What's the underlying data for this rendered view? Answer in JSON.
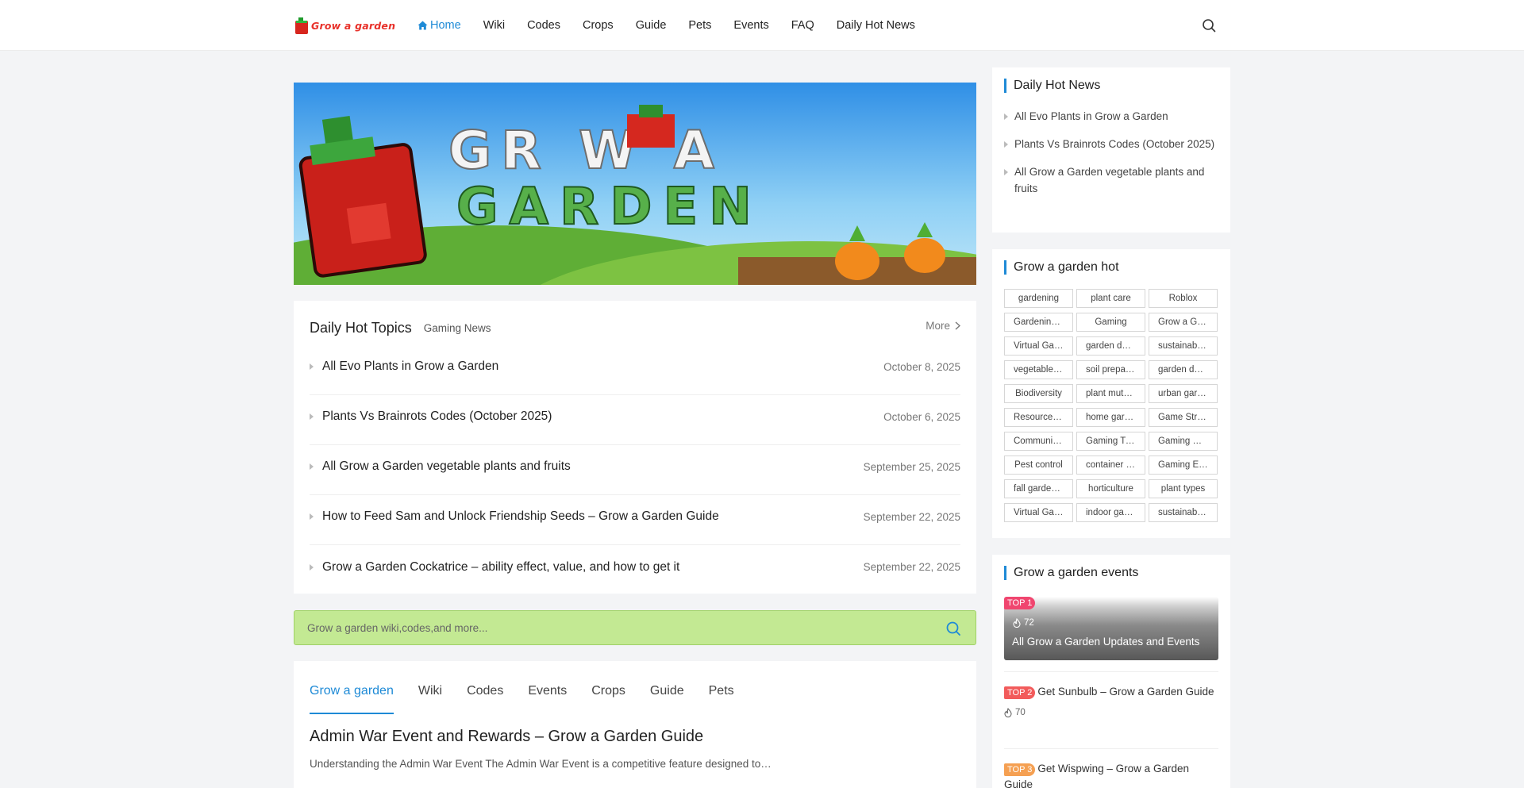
{
  "header": {
    "logo_text": "Grow a garden",
    "nav": [
      {
        "label": "Home",
        "active": true
      },
      {
        "label": "Wiki"
      },
      {
        "label": "Codes"
      },
      {
        "label": "Crops"
      },
      {
        "label": "Guide"
      },
      {
        "label": "Pets"
      },
      {
        "label": "Events"
      },
      {
        "label": "FAQ"
      },
      {
        "label": "Daily Hot News"
      }
    ]
  },
  "banner": {
    "text_line1": "GR W A",
    "text_line2": "GARDEN"
  },
  "topics": {
    "title": "Daily Hot Topics",
    "subtitle": "Gaming News",
    "more_label": "More",
    "items": [
      {
        "title": "All Evo Plants in Grow a Garden",
        "date": "October 8, 2025"
      },
      {
        "title": "Plants Vs Brainrots Codes (October 2025)",
        "date": "October 6, 2025"
      },
      {
        "title": "All Grow a Garden vegetable plants and fruits",
        "date": "September 25, 2025"
      },
      {
        "title": "How to Feed Sam and Unlock Friendship Seeds – Grow a Garden Guide",
        "date": "September 22, 2025"
      },
      {
        "title": "Grow a Garden Cockatrice – ability effect, value, and how to get it",
        "date": "September 22, 2025"
      }
    ]
  },
  "search": {
    "placeholder": "Grow a garden wiki,codes,and more..."
  },
  "tabs": {
    "items": [
      {
        "label": "Grow a garden",
        "active": true
      },
      {
        "label": "Wiki"
      },
      {
        "label": "Codes"
      },
      {
        "label": "Events"
      },
      {
        "label": "Crops"
      },
      {
        "label": "Guide"
      },
      {
        "label": "Pets"
      }
    ],
    "article_title": "Admin War Event and Rewards – Grow a Garden Guide",
    "article_excerpt": "Understanding the Admin War Event The Admin War Event is a competitive feature designed to…"
  },
  "sidebar": {
    "news": {
      "title": "Daily Hot News",
      "items": [
        "All Evo Plants in Grow a Garden",
        "Plants Vs Brainrots Codes (October 2025)",
        "All Grow a Garden vegetable plants and fruits"
      ]
    },
    "hot": {
      "title": "Grow a garden hot",
      "tags": [
        "gardening",
        "plant care",
        "Roblox",
        "Gardening Tips",
        "Gaming",
        "Grow a Garden",
        "Virtual Gardening",
        "garden design",
        "sustainable gardening",
        "vegetable gardening",
        "soil preparation",
        "garden decor",
        "Biodiversity",
        "plant mutations",
        "urban gardening",
        "Resource Management",
        "home gardening",
        "Game Strategy",
        "Community Events",
        "Gaming Tips",
        "Gaming Guide",
        "Pest control",
        "container gardening",
        "Gaming Events",
        "fall gardening",
        "horticulture",
        "plant types",
        "Virtual Garden",
        "indoor gardening",
        "sustainable living"
      ]
    },
    "events": {
      "title": "Grow a garden events",
      "items": [
        {
          "rank": "TOP 1",
          "title": "All Grow a Garden Updates and Events",
          "likes": "72"
        },
        {
          "rank": "TOP 2",
          "title": "Get Sunbulb – Grow a Garden Guide",
          "likes": "70"
        },
        {
          "rank": "TOP 3",
          "title": "Get Wispwing – Grow a Garden Guide",
          "likes": ""
        }
      ]
    }
  },
  "colors": {
    "accent": "#1e8ad6",
    "search_bg": "#c3e993",
    "logo_red": "#e8312a"
  }
}
